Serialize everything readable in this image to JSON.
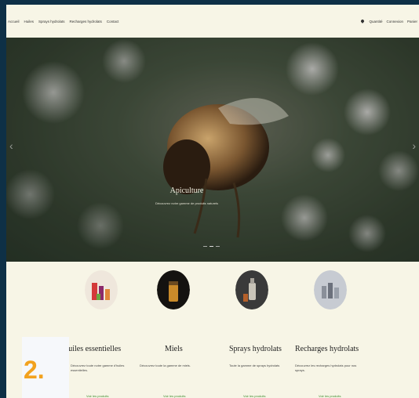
{
  "nav": {
    "links": [
      "Accueil",
      "Huiles",
      "Sprays hydrolats",
      "Recharges hydrolats",
      "Contact"
    ],
    "right": [
      "Quantité",
      "Connexion",
      "Panier"
    ]
  },
  "hero": {
    "title": "Apiculture",
    "subtitle": "Découvrez notre gamme de produits naturels"
  },
  "cards": [
    {
      "title": "Huiles essentielles",
      "desc": "Découvrez toute notre gamme d'huiles essentielles.",
      "link": "Voir les produits",
      "icon": "essential-oils-image"
    },
    {
      "title": "Miels",
      "desc": "Découvrez toute la gamme de miels.",
      "link": "Voir les produits",
      "icon": "honey-jar-image"
    },
    {
      "title": "Sprays hydrolats",
      "desc": "Toute la gamme de sprays hydrolats",
      "link": "Voir les produits",
      "icon": "spray-bottle-image"
    },
    {
      "title": "Recharges hydrolats",
      "desc": "Découvrez les recharges hydrolats pour nos sprays.",
      "link": "Voir les produits",
      "icon": "refill-bottles-image"
    }
  ],
  "badge": {
    "number": "2."
  },
  "colors": {
    "accent": "#f2a21e",
    "background": "#f7f5e6",
    "frame": "#0e3046",
    "link": "#3f8a2f"
  }
}
